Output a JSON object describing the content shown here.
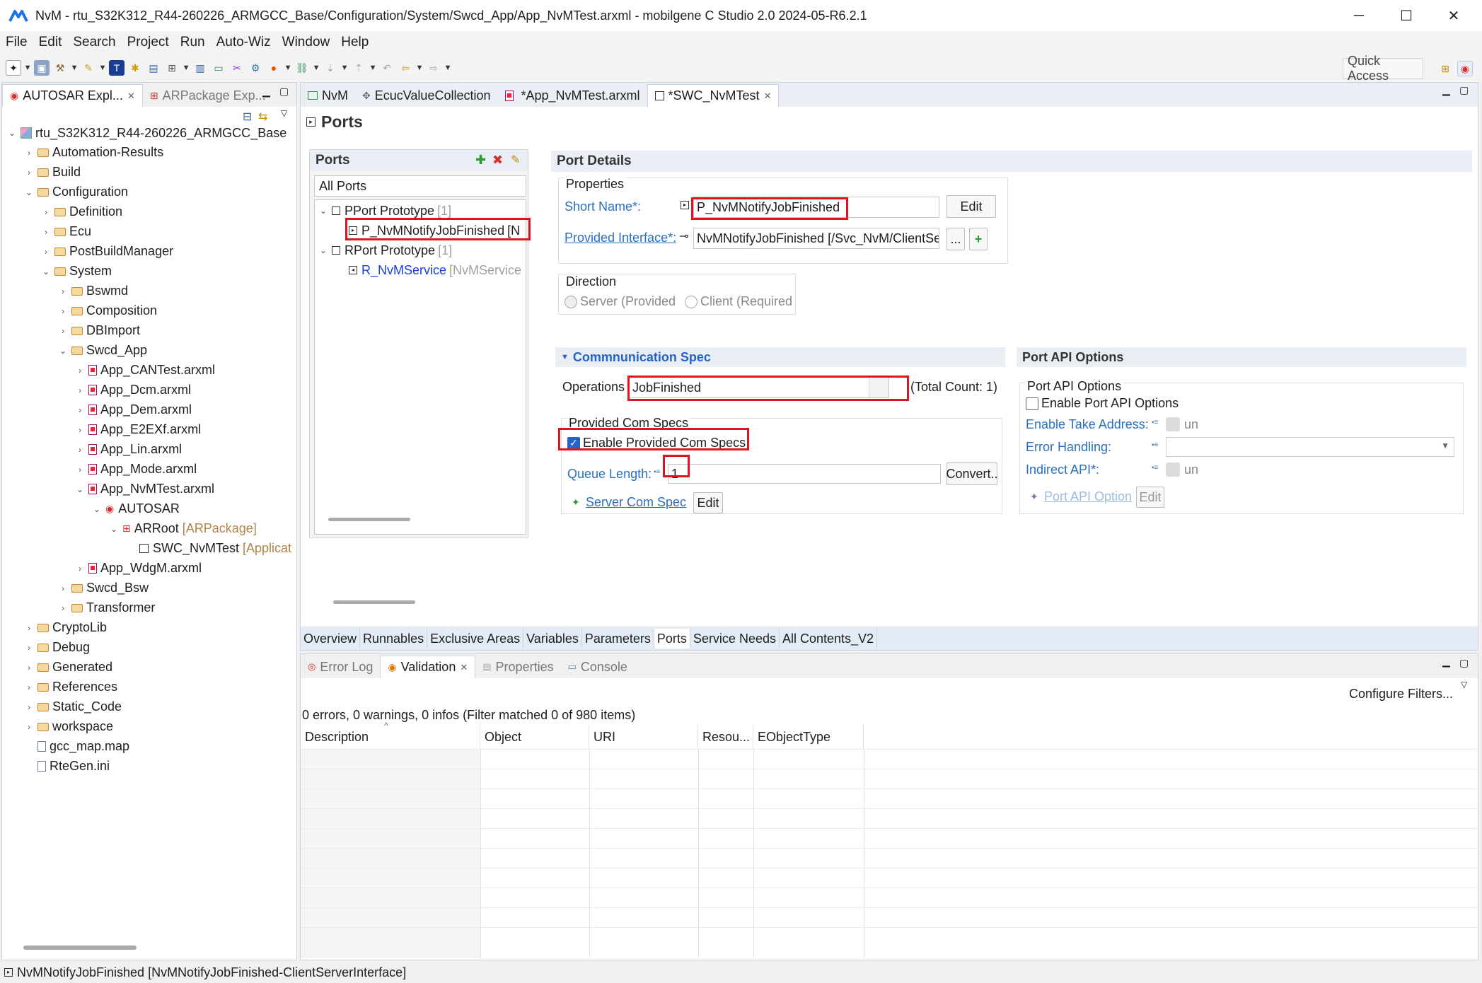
{
  "window": {
    "title": "NvM - rtu_S32K312_R44-260226_ARMGCC_Base/Configuration/System/Swcd_App/App_NvMTest.arxml - mobilgene C Studio 2.0 2024-05-R6.2.1",
    "minimize": "─",
    "maximize": "☐",
    "close": "✕"
  },
  "menu": [
    "File",
    "Edit",
    "Search",
    "Project",
    "Run",
    "Auto-Wiz",
    "Window",
    "Help"
  ],
  "quick_access": "Quick Access",
  "explorer": {
    "tabs": [
      {
        "label": "AUTOSAR Expl...",
        "close": "✕"
      },
      {
        "label": "ARPackage Exp..."
      }
    ],
    "tree": [
      {
        "label": "rtu_S32K312_R44-260226_ARMGCC_Base",
        "icon": "project-icon",
        "depth": 0,
        "chev": "⌄"
      },
      {
        "label": "Automation-Results",
        "icon": "folder-icon",
        "depth": 1,
        "chev": "›"
      },
      {
        "label": "Build",
        "icon": "folder-icon",
        "depth": 1,
        "chev": "›"
      },
      {
        "label": "Configuration",
        "icon": "folder-icon",
        "depth": 1,
        "chev": "⌄"
      },
      {
        "label": "Definition",
        "icon": "folder-icon",
        "depth": 2,
        "chev": "›"
      },
      {
        "label": "Ecu",
        "icon": "folder-icon",
        "depth": 2,
        "chev": "›"
      },
      {
        "label": "PostBuildManager",
        "icon": "folder-icon",
        "depth": 2,
        "chev": "›"
      },
      {
        "label": "System",
        "icon": "folder-icon",
        "depth": 2,
        "chev": "⌄"
      },
      {
        "label": "Bswmd",
        "icon": "folder-icon",
        "depth": 3,
        "chev": "›"
      },
      {
        "label": "Composition",
        "icon": "folder-icon",
        "depth": 3,
        "chev": "›"
      },
      {
        "label": "DBImport",
        "icon": "folder-icon",
        "depth": 3,
        "chev": "›"
      },
      {
        "label": "Swcd_App",
        "icon": "folder-icon",
        "depth": 3,
        "chev": "⌄"
      },
      {
        "label": "App_CANTest.arxml",
        "icon": "arxml-file-icon",
        "depth": 4,
        "chev": "›"
      },
      {
        "label": "App_Dcm.arxml",
        "icon": "arxml-file-icon",
        "depth": 4,
        "chev": "›"
      },
      {
        "label": "App_Dem.arxml",
        "icon": "arxml-file-icon",
        "depth": 4,
        "chev": "›"
      },
      {
        "label": "App_E2EXf.arxml",
        "icon": "arxml-file-icon",
        "depth": 4,
        "chev": "›"
      },
      {
        "label": "App_Lin.arxml",
        "icon": "arxml-file-icon",
        "depth": 4,
        "chev": "›"
      },
      {
        "label": "App_Mode.arxml",
        "icon": "arxml-file-icon",
        "depth": 4,
        "chev": "›"
      },
      {
        "label": "App_NvMTest.arxml",
        "icon": "arxml-file-icon",
        "depth": 4,
        "chev": "⌄"
      },
      {
        "label": "AUTOSAR",
        "icon": "autosar-icon",
        "depth": 5,
        "chev": "⌄"
      },
      {
        "label": "ARRoot",
        "suffix": "[ARPackage]",
        "icon": "package-icon",
        "depth": 6,
        "chev": "⌄"
      },
      {
        "label": "SWC_NvMTest",
        "suffix": "[Applicat",
        "icon": "swc-icon",
        "depth": 7,
        "chev": ""
      },
      {
        "label": "App_WdgM.arxml",
        "icon": "arxml-file-icon",
        "depth": 4,
        "chev": "›"
      },
      {
        "label": "Swcd_Bsw",
        "icon": "folder-icon",
        "depth": 3,
        "chev": "›"
      },
      {
        "label": "Transformer",
        "icon": "folder-icon",
        "depth": 3,
        "chev": "›"
      },
      {
        "label": "CryptoLib",
        "icon": "folder-icon",
        "depth": 1,
        "chev": "›"
      },
      {
        "label": "Debug",
        "icon": "folder-icon",
        "depth": 1,
        "chev": "›"
      },
      {
        "label": "Generated",
        "icon": "folder-icon",
        "depth": 1,
        "chev": "›"
      },
      {
        "label": "References",
        "icon": "folder-icon",
        "depth": 1,
        "chev": "›"
      },
      {
        "label": "Static_Code",
        "icon": "folder-icon",
        "depth": 1,
        "chev": "›"
      },
      {
        "label": "workspace",
        "icon": "folder-icon",
        "depth": 1,
        "chev": "›"
      },
      {
        "label": "gcc_map.map",
        "icon": "plain-file-icon",
        "depth": 1,
        "chev": ""
      },
      {
        "label": "RteGen.ini",
        "icon": "plain-file-icon",
        "depth": 1,
        "chev": ""
      }
    ]
  },
  "editor_tabs": [
    {
      "label": "NvM"
    },
    {
      "label": "EcucValueCollection"
    },
    {
      "label": "*App_NvMTest.arxml"
    },
    {
      "label": "*SWC_NvMTest",
      "close": "✕"
    }
  ],
  "page_title": "Ports",
  "ports_panel": {
    "title": "Ports",
    "filter": "All Ports",
    "pport_group": "PPort Prototype",
    "pport_count": "[1]",
    "pport_item": "P_NvMNotifyJobFinished",
    "pport_item_suffix": "[N",
    "rport_group": "RPort Prototype",
    "rport_count": "[1]",
    "rport_item": "R_NvMService",
    "rport_item_suffix": "[NvMService"
  },
  "port_details": {
    "title": "Port Details",
    "properties_title": "Properties",
    "short_name_label": "Short Name*:",
    "short_name_value": "P_NvMNotifyJobFinished",
    "edit_label": "Edit",
    "provided_interface_label": "Provided Interface*:",
    "provided_interface_value": "NvMNotifyJobFinished [/Svc_NvM/ClientSer",
    "browse_label": "...",
    "add_label": "+",
    "direction_title": "Direction",
    "server_label": "Server (Provided",
    "client_label": "Client (Required"
  },
  "com_spec": {
    "title": "Commnunication Spec",
    "operations_label": "Operations",
    "operations_value": "JobFinished",
    "total_count": "(Total Count: 1)",
    "provided_title": "Provided Com Specs",
    "enable_label": "Enable Provided Com Specs",
    "enable_checked": true,
    "queue_label": "Queue Length:",
    "queue_value": "1",
    "convert_label": "Convert..",
    "server_com_spec_label": "Server Com Spec",
    "edit_label": "Edit"
  },
  "port_api": {
    "title": "Port API Options",
    "group_title": "Port API Options",
    "enable_label": "Enable Port API Options",
    "take_address_label": "Enable Take Address:",
    "take_address_value": "un",
    "error_handling_label": "Error Handling:",
    "indirect_label": "Indirect API*:",
    "indirect_value": "un",
    "port_api_option_label": "Port API Option",
    "edit_label": "Edit"
  },
  "editor_bottom_tabs": [
    "Overview",
    "Runnables",
    "Exclusive Areas",
    "Variables",
    "Parameters",
    "Ports",
    "Service Needs",
    "All Contents_V2"
  ],
  "active_editor_bottom_tab": "Ports",
  "problems": {
    "tabs": [
      {
        "label": "Error Log"
      },
      {
        "label": "Validation",
        "close": "✕"
      },
      {
        "label": "Properties"
      },
      {
        "label": "Console"
      }
    ],
    "configure_filters": "Configure Filters...",
    "summary": "0 errors, 0 warnings, 0 infos (Filter matched 0 of 980 items)",
    "columns": [
      "Description",
      "Object",
      "URI",
      "Resou...",
      "EObjectType"
    ]
  },
  "status_bar": "NvMNotifyJobFinished [NvMNotifyJobFinished-ClientServerInterface]",
  "colors": {
    "highlight": "#e0141b",
    "link": "#2a6fbd",
    "panel_border": "#c9d3e1"
  }
}
